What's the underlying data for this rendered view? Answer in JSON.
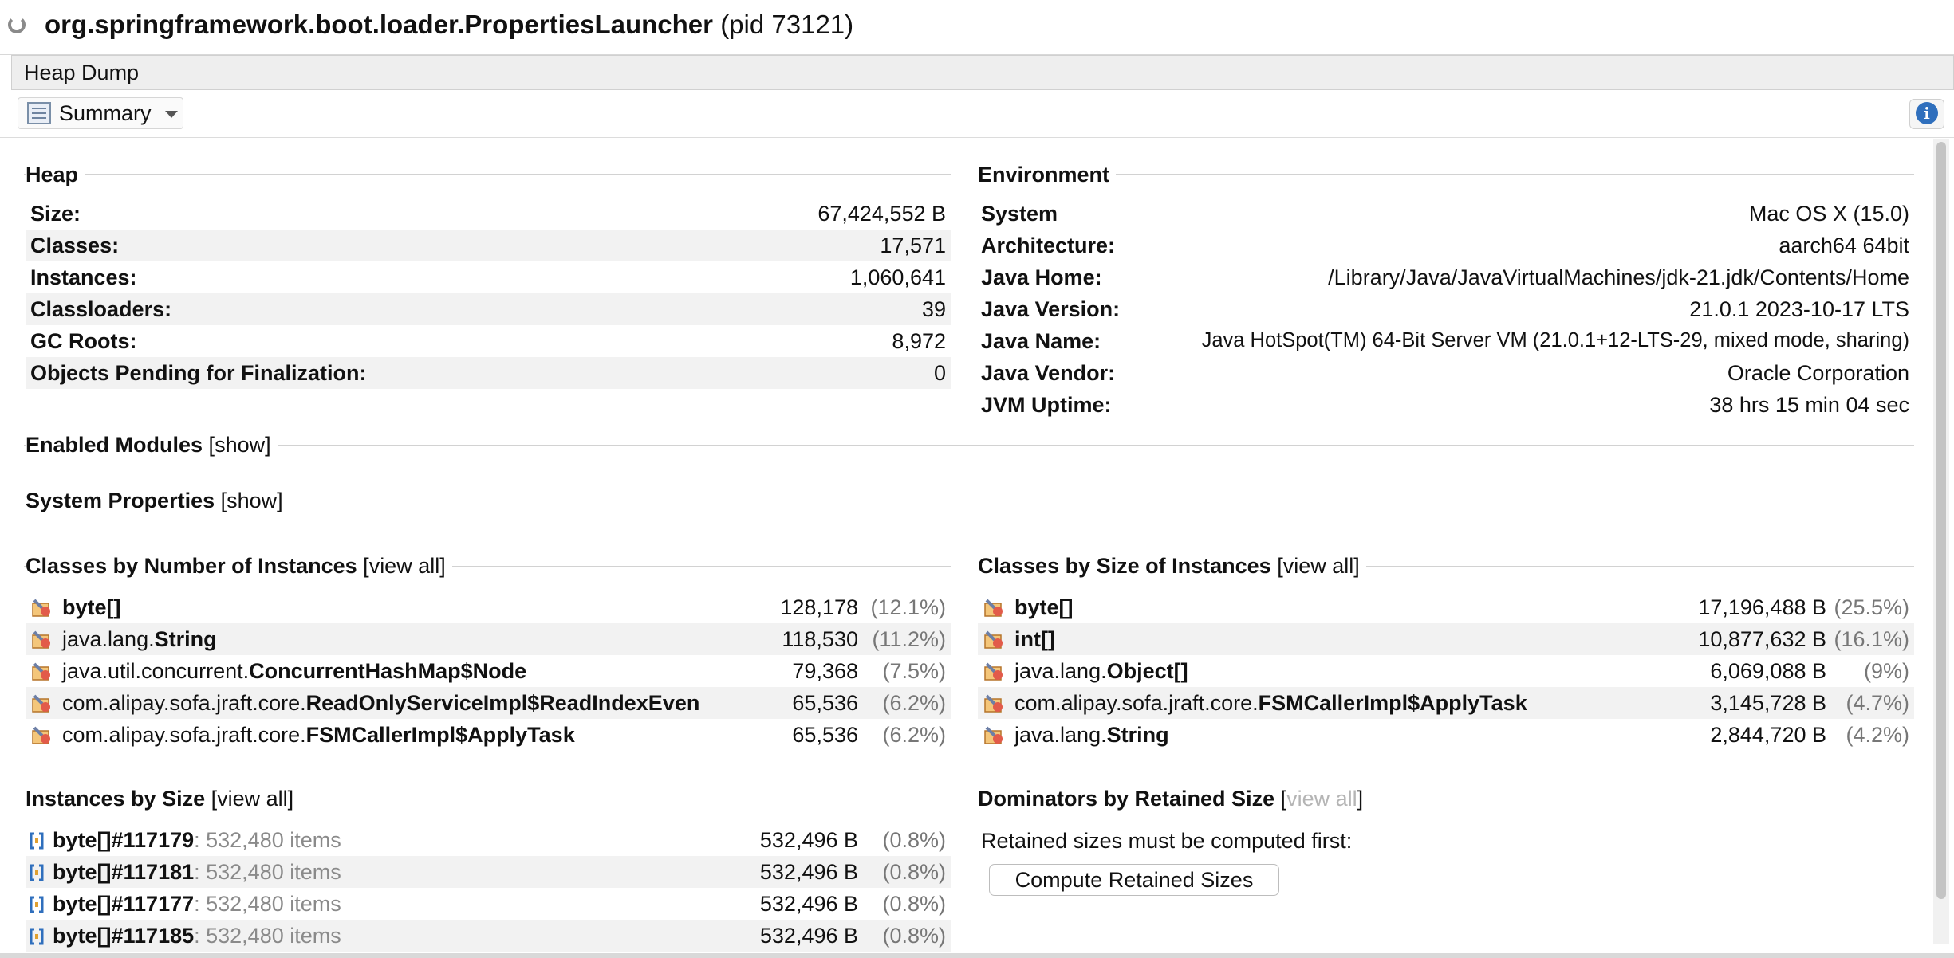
{
  "window": {
    "title_main": "org.springframework.boot.loader.PropertiesLauncher",
    "title_pid": "(pid 73121)"
  },
  "tab": {
    "label": "Heap Dump"
  },
  "toolbar": {
    "view_label": "Summary",
    "info_icon": "i"
  },
  "heap": {
    "title": "Heap",
    "rows": [
      {
        "key": "Size:",
        "value": "67,424,552 B"
      },
      {
        "key": "Classes:",
        "value": "17,571"
      },
      {
        "key": "Instances:",
        "value": "1,060,641"
      },
      {
        "key": "Classloaders:",
        "value": "39"
      },
      {
        "key": "GC Roots:",
        "value": "8,972"
      },
      {
        "key": "Objects Pending for Finalization:",
        "value": "0"
      }
    ]
  },
  "environment": {
    "title": "Environment",
    "rows": [
      {
        "key": "System",
        "value": "Mac OS X (15.0)"
      },
      {
        "key": "Architecture:",
        "value": "aarch64 64bit"
      },
      {
        "key": "Java Home:",
        "value": "/Library/Java/JavaVirtualMachines/jdk-21.jdk/Contents/Home"
      },
      {
        "key": "Java Version:",
        "value": "21.0.1 2023-10-17 LTS"
      },
      {
        "key": "Java Name:",
        "value": "Java HotSpot(TM) 64-Bit Server VM (21.0.1+12-LTS-29, mixed mode, sharing)"
      },
      {
        "key": "Java Vendor:",
        "value": "Oracle Corporation"
      },
      {
        "key": "JVM Uptime:",
        "value": "38 hrs 15 min 04 sec"
      }
    ]
  },
  "enabled_modules": {
    "title": "Enabled Modules",
    "link": "show"
  },
  "system_properties": {
    "title": "System Properties",
    "link": "show"
  },
  "classes_by_number": {
    "title": "Classes by Number of Instances",
    "link": "view all",
    "rows": [
      {
        "prefix": "",
        "name": "byte[]",
        "count": "128,178",
        "pct": "(12.1%)"
      },
      {
        "prefix": "java.lang.",
        "name": "String",
        "count": "118,530",
        "pct": "(11.2%)"
      },
      {
        "prefix": "java.util.concurrent.",
        "name": "ConcurrentHashMap$Node",
        "count": "79,368",
        "pct": "(7.5%)"
      },
      {
        "prefix": "com.alipay.sofa.jraft.core.",
        "name": "ReadOnlyServiceImpl$ReadIndexEven",
        "count": "65,536",
        "pct": "(6.2%)"
      },
      {
        "prefix": "com.alipay.sofa.jraft.core.",
        "name": "FSMCallerImpl$ApplyTask",
        "count": "65,536",
        "pct": "(6.2%)"
      }
    ]
  },
  "classes_by_size": {
    "title": "Classes by Size of Instances",
    "link": "view all",
    "rows": [
      {
        "prefix": "",
        "name": "byte[]",
        "size": "17,196,488 B",
        "pct": "(25.5%)"
      },
      {
        "prefix": "",
        "name": "int[]",
        "size": "10,877,632 B",
        "pct": "(16.1%)"
      },
      {
        "prefix": "java.lang.",
        "name": "Object[]",
        "size": "6,069,088 B",
        "pct": "(9%)"
      },
      {
        "prefix": "com.alipay.sofa.jraft.core.",
        "name": "FSMCallerImpl$ApplyTask",
        "size": "3,145,728 B",
        "pct": "(4.7%)"
      },
      {
        "prefix": "java.lang.",
        "name": "String",
        "size": "2,844,720 B",
        "pct": "(4.2%)"
      }
    ]
  },
  "instances_by_size": {
    "title": "Instances by Size",
    "link": "view all",
    "rows": [
      {
        "name": "byte[]#117179",
        "items": ": 532,480 items",
        "size": "532,496 B",
        "pct": "(0.8%)"
      },
      {
        "name": "byte[]#117181",
        "items": ": 532,480 items",
        "size": "532,496 B",
        "pct": "(0.8%)"
      },
      {
        "name": "byte[]#117177",
        "items": ": 532,480 items",
        "size": "532,496 B",
        "pct": "(0.8%)"
      },
      {
        "name": "byte[]#117185",
        "items": ": 532,480 items",
        "size": "532,496 B",
        "pct": "(0.8%)"
      }
    ]
  },
  "dominators": {
    "title": "Dominators by Retained Size",
    "link": "view all",
    "message": "Retained sizes must be computed first:",
    "button": "Compute Retained Sizes"
  }
}
